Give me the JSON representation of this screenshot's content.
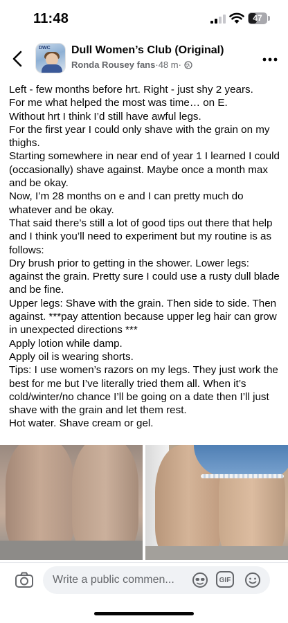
{
  "status_bar": {
    "time": "11:48",
    "battery": "47",
    "battery_level": 0.47
  },
  "header": {
    "group_name": "Dull Women’s Club (Original)",
    "author": "Ronda Rousey fans",
    "separator": " · ",
    "timestamp": "48 m",
    "dot": " · ",
    "avatar_text": "DWC"
  },
  "post": {
    "lines": [
      "Left - few months before hrt. Right - just shy 2 years.",
      "For me what helped the most was time… on E.",
      "Without hrt I think I’d still have awful legs.",
      "For the first year I could only shave with the grain on my thighs.",
      "Starting somewhere in near end of year 1 I learned I could (occasionally) shave against. Maybe once a month max and be okay.",
      "Now, I’m 28 months on e and I can pretty much do whatever and be okay.",
      "That said there’s still a lot of good tips out there that help and I think you’ll need to experiment but my routine is as follows:",
      "Dry brush prior to getting in the shower. Lower legs: against the grain. Pretty sure I could use a rusty dull blade and be fine.",
      "Upper legs: Shave with the grain. Then side to side. Then against. ***pay attention because upper leg hair can grow in unexpected directions ***",
      "Apply lotion while damp.",
      "Apply oil is wearing shorts.",
      "Tips: I use women’s razors on my legs. They just work the best for me but I’ve literally tried them all. When it’s cold/winter/no chance I’ll be going on a date then I’ll just shave with the grain and let them rest.",
      "Hot water. Shave cream or gel."
    ]
  },
  "comment_bar": {
    "placeholder": "Write a public commen...",
    "gif_label": "GIF"
  },
  "icons": {
    "back": "chevron-left-icon",
    "more": "more-horizontal-icon",
    "globe": "globe-icon",
    "camera": "camera-icon",
    "avatar_sticker": "avatar-sticker-icon",
    "gif": "gif-icon",
    "emoji": "emoji-icon"
  },
  "colors": {
    "text": "#050505",
    "secondary_text": "#65676b",
    "input_bg": "#f0f2f5"
  }
}
